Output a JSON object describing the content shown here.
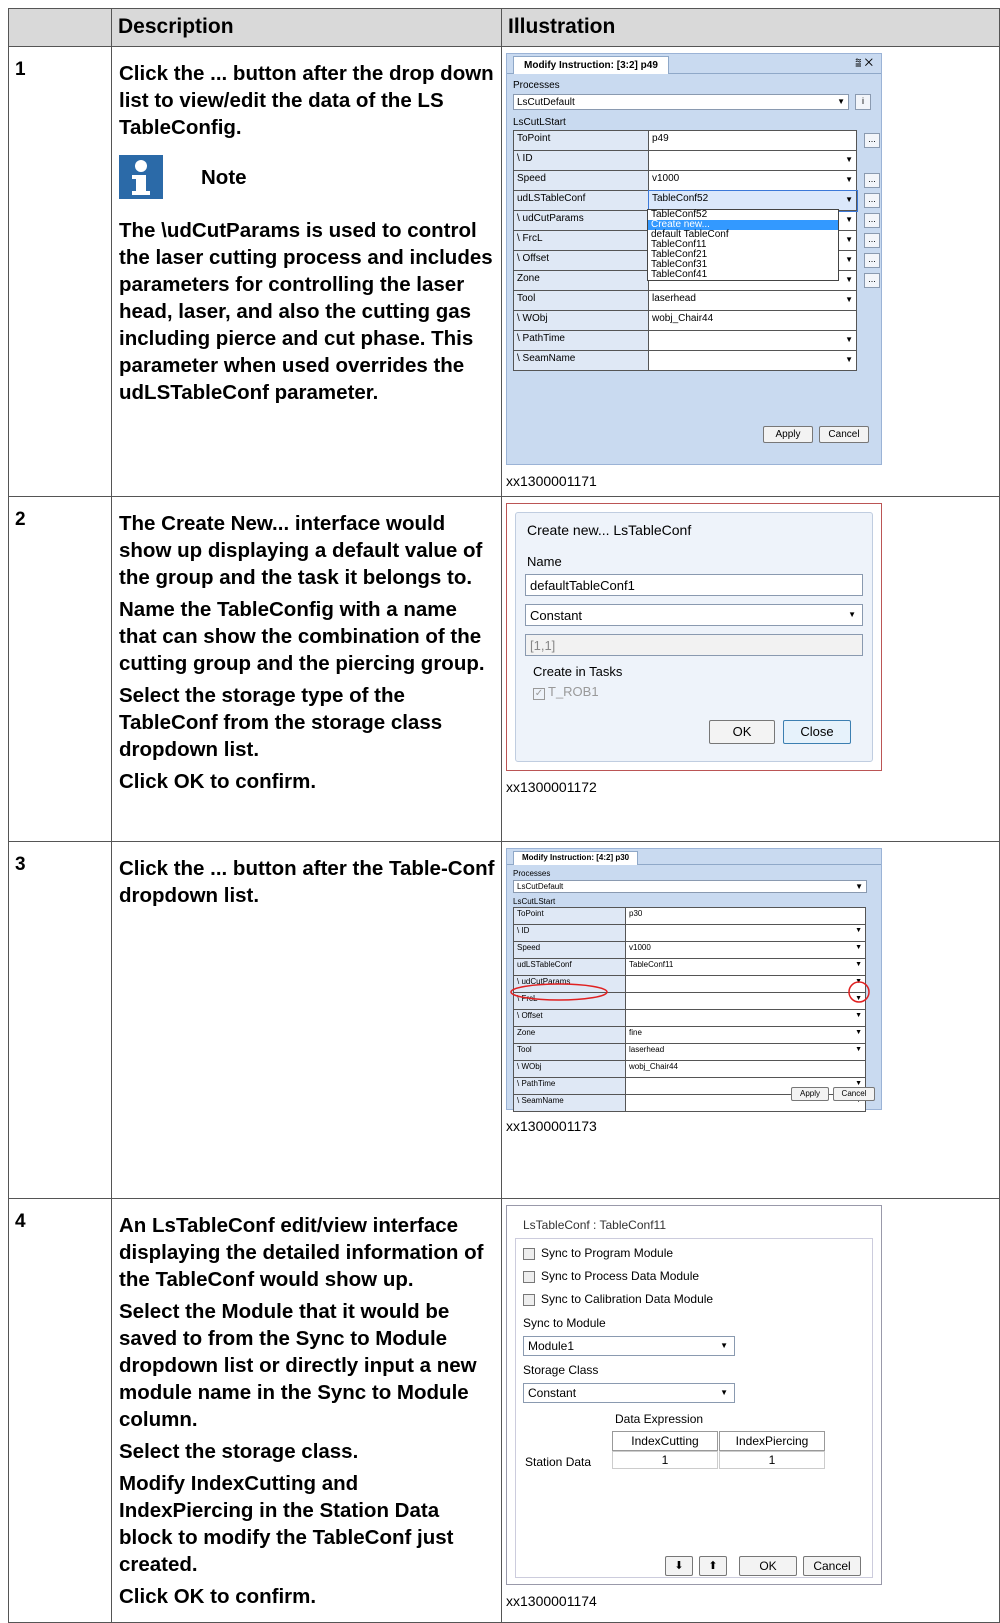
{
  "headers": {
    "col1": "",
    "col2": "Description",
    "col3": "Illustration"
  },
  "step1": {
    "num": "1",
    "p1a": "Click the ",
    "p1b": "...",
    "p1c": " button after the drop down list to view/edit the data of the LS TableConfig.",
    "note_label": "Note",
    "p2a": "The \\",
    "p2b": "udCutParams",
    "p2c": " is used to control the laser cutting process and includes parameters for controlling the laser head, laser, and also the cutting gas including pierce and cut phase. This parameter when used overrides the ",
    "p2d": "udLSTableConf",
    "p2e": " parameter.",
    "caption": "xx1300001171",
    "shot": {
      "tab": "Modify Instruction: [3:2] p49",
      "tabctl": "⩰ ✕",
      "processes": "Processes",
      "process_value": "LsCutDefault",
      "info": "i",
      "section": "LsCutLStart",
      "rows": [
        {
          "k": "ToPoint",
          "v": "p49",
          "dd": false,
          "btn": "..."
        },
        {
          "k": "\\ ID",
          "v": "",
          "dd": true,
          "btn": ""
        },
        {
          "k": "Speed",
          "v": "v1000",
          "dd": true,
          "btn": "..."
        },
        {
          "k": "udLSTableConf",
          "v": "TableConf52",
          "dd": true,
          "btn": "..."
        },
        {
          "k": "\\ udCutParams",
          "v": "",
          "dd": true,
          "btn": "..."
        },
        {
          "k": "\\ FrcL",
          "v": "",
          "dd": true,
          "btn": "..."
        },
        {
          "k": "\\ Offset",
          "v": "",
          "dd": true,
          "btn": "..."
        },
        {
          "k": "Zone",
          "v": "",
          "dd": true,
          "btn": "..."
        },
        {
          "k": "Tool",
          "v": "laserhead",
          "dd": true,
          "btn": ""
        },
        {
          "k": "\\ WObj",
          "v": "wobj_Chair44",
          "dd": false,
          "btn": ""
        },
        {
          "k": "\\ PathTime",
          "v": "",
          "dd": true,
          "btn": ""
        },
        {
          "k": "\\ SeamName",
          "v": "",
          "dd": true,
          "btn": ""
        }
      ],
      "dropdown": [
        "TableConf52",
        "Create new...",
        "default TableConf",
        "TableConf11",
        "TableConf21",
        "TableConf31",
        "TableConf41"
      ],
      "apply": "Apply",
      "cancel": "Cancel"
    }
  },
  "step2": {
    "num": "2",
    "p1a": "The ",
    "p1b": "Create New...",
    "p1c": " interface would show up displaying a default value of the group and the task it belongs to.",
    "p2": "Name the TableConfig with a name that can show the combination of the cutting group and the piercing group.",
    "p3": "Select the storage type of the TableConf from the storage class dropdown list.",
    "p4a": "Click ",
    "p4b": "OK",
    "p4c": " to confirm.",
    "caption": "xx1300001172",
    "shot": {
      "title": "Create new... LsTableConf",
      "name_label": "Name",
      "name_value": "defaultTableConf1",
      "storage": "Constant",
      "dims": "[1,1]",
      "tasks_label": "Create in Tasks",
      "task": "T_ROB1",
      "ok": "OK",
      "close": "Close"
    }
  },
  "step3": {
    "num": "3",
    "p1a": "Click the ",
    "p1b": "...",
    "p1c": " button after the Table-Conf dropdown list.",
    "caption": "xx1300001173",
    "shot": {
      "tab": "Modify Instruction: [4:2] p30",
      "processes": "Processes",
      "process_value": "LsCutDefault",
      "section": "LsCutLStart",
      "rows": [
        {
          "k": "ToPoint",
          "v": "p30"
        },
        {
          "k": "\\ ID",
          "v": ""
        },
        {
          "k": "Speed",
          "v": "v1000"
        },
        {
          "k": "udLSTableConf",
          "v": "TableConf11"
        },
        {
          "k": "\\ udCutParams",
          "v": ""
        },
        {
          "k": "\\ FrcL",
          "v": ""
        },
        {
          "k": "\\ Offset",
          "v": ""
        },
        {
          "k": "Zone",
          "v": "fine"
        },
        {
          "k": "Tool",
          "v": "laserhead"
        },
        {
          "k": "\\ WObj",
          "v": "wobj_Chair44"
        },
        {
          "k": "\\ PathTime",
          "v": ""
        },
        {
          "k": "\\ SeamName",
          "v": ""
        }
      ],
      "apply": "Apply",
      "cancel": "Cancel",
      "highlight_color": "#e02020"
    }
  },
  "step4": {
    "num": "4",
    "p1a": "An ",
    "p1b": "LsTableConf",
    "p1c": " edit/view interface displaying the detailed information of the TableConf would show up.",
    "p2a": "Select the Module that it would be saved to from the ",
    "p2b": "Sync to Module",
    "p2c": " dropdown list or directly input a new module name in the Sync to Module column.",
    "p3": "Select the storage class.",
    "p4a": "Modify ",
    "p4b": "IndexCutting",
    "p4c": " and ",
    "p4d": "IndexPiercing",
    "p4e": " in the ",
    "p4f": "Station Data",
    "p4g": " block to modify the TableConf just created.",
    "p5a": "Click ",
    "p5b": "OK",
    "p5c": " to confirm.",
    "caption": "xx1300001174",
    "shot": {
      "title": "LsTableConf : TableConf11",
      "chk1": "Sync to Program Module",
      "chk2": "Sync to Process Data Module",
      "chk3": "Sync to Calibration Data Module",
      "sync_label": "Sync to Module",
      "sync_value": "Module1",
      "storage_label": "Storage Class",
      "storage_value": "Constant",
      "expr_label": "Data Expression",
      "col1": "IndexCutting",
      "col2": "IndexPiercing",
      "row_label": "Station Data",
      "val1": "1",
      "val2": "1",
      "down": "⬇",
      "up": "⬆",
      "ok": "OK",
      "cancel": "Cancel"
    }
  }
}
